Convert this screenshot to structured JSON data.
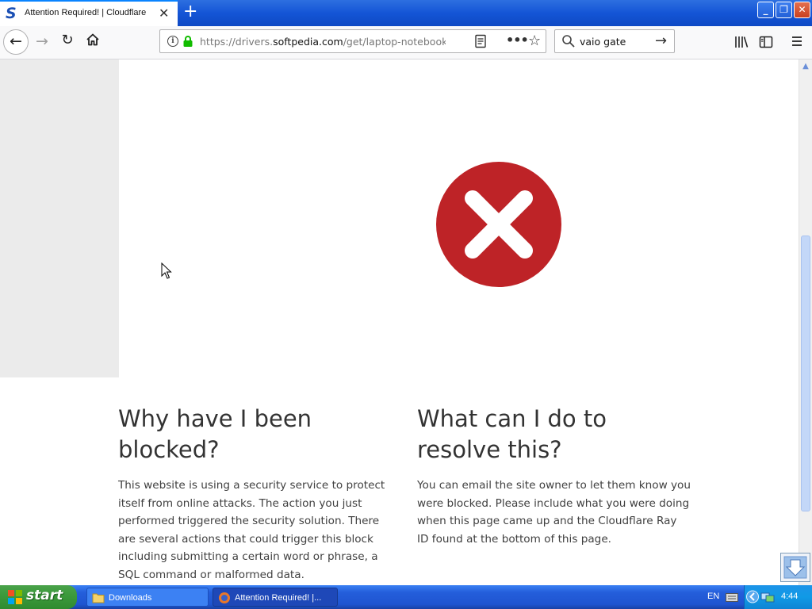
{
  "window": {
    "tab_title": "Attention Required! | Cloudflare",
    "tab_favicon_letter": "S",
    "new_tab_symbol": "+",
    "close_tab_symbol": "✕",
    "minimize_symbol": "_",
    "maximize_symbol": "❐",
    "close_symbol": "✕"
  },
  "toolbar": {
    "back_symbol": "←",
    "forward_symbol": "→",
    "reload_symbol": "↻",
    "url_prefix": "https://drivers.",
    "url_host": "softpedia.com",
    "url_rest": "/get/laptop-notebook/So",
    "search_value": "vaio gate",
    "search_go_symbol": "→",
    "more_symbol": "•••",
    "star_symbol": "☆"
  },
  "page": {
    "left_heading": "Why have I been blocked?",
    "left_body": "This website is using a security service to protect itself from online attacks. The action you just performed triggered the security solution. There are several actions that could trigger this block including submitting a certain word or phrase, a SQL command or malformed data.",
    "right_heading": "What can I do to resolve this?",
    "right_body": "You can email the site owner to let them know you were blocked. Please include what you were doing when this page came up and the Cloudflare Ray ID found at the bottom of this page."
  },
  "taskbar": {
    "start_label": "start",
    "items": [
      {
        "label": "Downloads"
      },
      {
        "label": "Attention Required! |..."
      }
    ],
    "language": "EN",
    "clock": "4:44"
  },
  "colors": {
    "error_red": "#be2327",
    "xp_blue": "#245edb",
    "start_green": "#3c9a3c"
  }
}
